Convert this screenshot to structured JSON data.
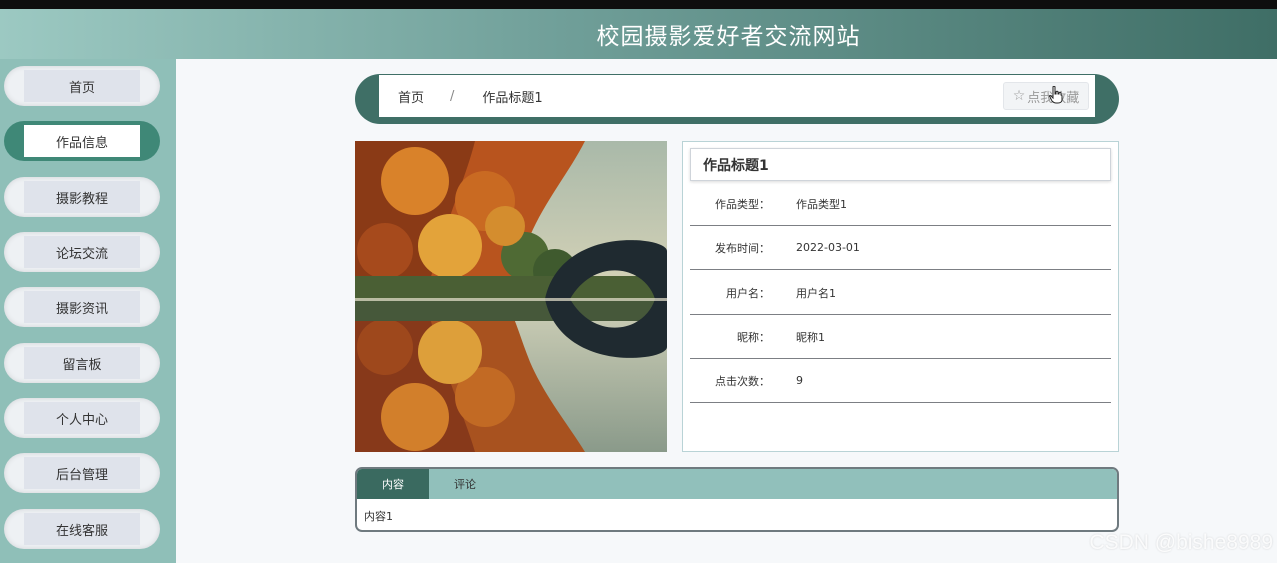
{
  "header": {
    "title": "校园摄影爱好者交流网站"
  },
  "sidebar": {
    "items": [
      {
        "label": "首页",
        "active": false
      },
      {
        "label": "作品信息",
        "active": true
      },
      {
        "label": "摄影教程",
        "active": false
      },
      {
        "label": "论坛交流",
        "active": false
      },
      {
        "label": "摄影资讯",
        "active": false
      },
      {
        "label": "留言板",
        "active": false
      },
      {
        "label": "个人中心",
        "active": false
      },
      {
        "label": "后台管理",
        "active": false
      },
      {
        "label": "在线客服",
        "active": false
      }
    ]
  },
  "breadcrumb": {
    "home": "首页",
    "separator": "/",
    "current": "作品标题1"
  },
  "favorite": {
    "label": "点我收藏",
    "icon": "star-outline-icon"
  },
  "detail": {
    "title": "作品标题1",
    "rows": [
      {
        "key": "作品类型：",
        "value": "作品类型1"
      },
      {
        "key": "发布时间：",
        "value": "2022-03-01"
      },
      {
        "key": "用户名：",
        "value": "用户名1"
      },
      {
        "key": "昵称：",
        "value": "昵称1"
      },
      {
        "key": "点击次数：",
        "value": "9"
      }
    ]
  },
  "tabs": {
    "items": [
      {
        "label": "内容"
      },
      {
        "label": "评论"
      }
    ],
    "content": "内容1"
  },
  "watermark": "CSDN @bishe8989",
  "colors": {
    "header_gradient": [
      "#9cc9c2",
      "#3f6e66"
    ],
    "sidebar_bg": "#8fbfb8",
    "active_nav": "#3f8877",
    "tab_bar": "#91c0bb",
    "tab_active": "#3a6a60"
  }
}
